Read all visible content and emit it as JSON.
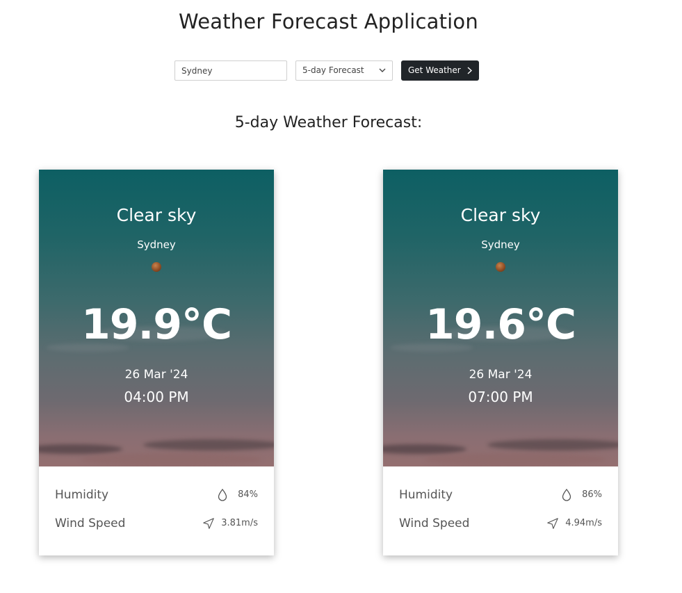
{
  "app": {
    "title": "Weather Forecast Application"
  },
  "search": {
    "city_value": "Sydney",
    "mode_selected": "5-day Forecast",
    "button_label": "Get Weather"
  },
  "section": {
    "title": "5-day Weather Forecast:"
  },
  "labels": {
    "humidity": "Humidity",
    "wind_speed": "Wind Speed"
  },
  "cards": [
    {
      "condition": "Clear sky",
      "city": "Sydney",
      "temperature": "19.9°C",
      "date": "26 Mar '24",
      "time": "04:00 PM",
      "humidity": "84%",
      "wind": "3.81m/s"
    },
    {
      "condition": "Clear sky",
      "city": "Sydney",
      "temperature": "19.6°C",
      "date": "26 Mar '24",
      "time": "07:00 PM",
      "humidity": "86%",
      "wind": "4.94m/s"
    }
  ],
  "icons": {
    "weather": "clear-sky-icon",
    "humidity": "droplet-icon",
    "wind": "navigation-arrow-icon",
    "dropdown": "chevron-down-icon",
    "button": "chevron-right-icon"
  }
}
